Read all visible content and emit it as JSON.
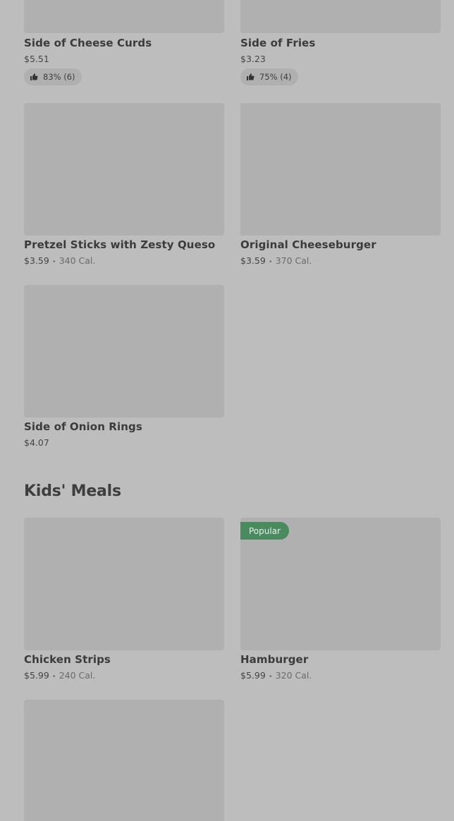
{
  "items_top": [
    {
      "name": "Side of Cheese Curds",
      "price": "$5.51",
      "rating": "83% (6)"
    },
    {
      "name": "Side of Fries",
      "price": "$3.23",
      "rating": "75% (4)"
    },
    {
      "name": "Pretzel Sticks with Zesty Queso",
      "price": "$3.59",
      "calories": "340 Cal."
    },
    {
      "name": "Original Cheeseburger",
      "price": "$3.59",
      "calories": "370 Cal."
    },
    {
      "name": "Side of Onion Rings",
      "price": "$4.07"
    }
  ],
  "kids_section": {
    "title": "Kids' Meals",
    "items": [
      {
        "name": "Chicken Strips",
        "price": "$5.99",
        "calories": "240 Cal."
      },
      {
        "name": "Hamburger",
        "price": "$5.99",
        "calories": "320 Cal.",
        "badge": "Popular"
      }
    ]
  },
  "separator": "•",
  "colors": {
    "background": "#bdbdbd",
    "image_placeholder": "#b0b0b0",
    "popular_badge": "#4a8a5f"
  },
  "icons": {
    "rating": "thumbs-up-icon"
  }
}
